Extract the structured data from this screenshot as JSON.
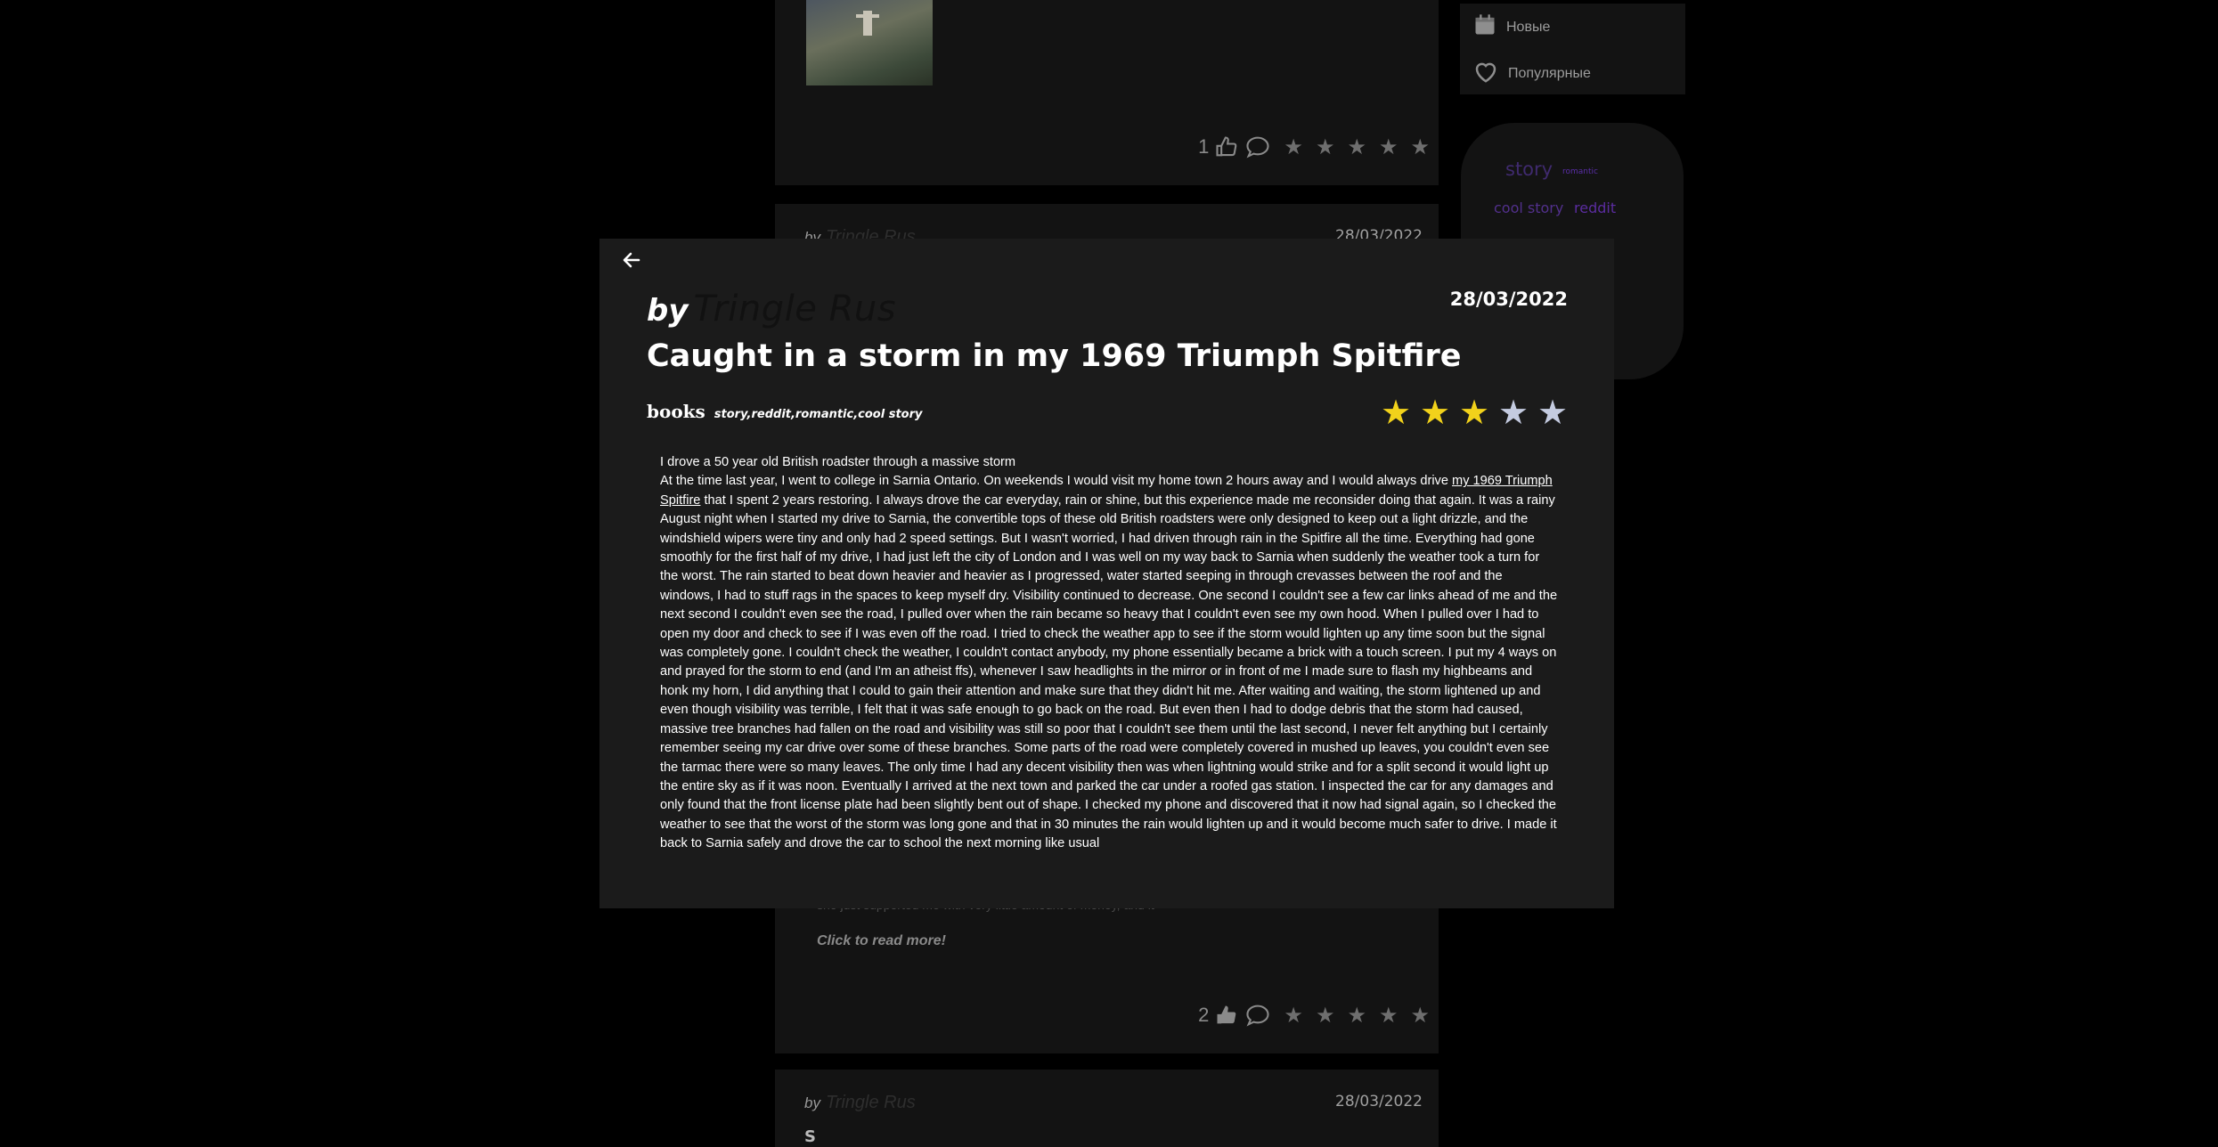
{
  "background": {
    "sidebar": {
      "items": [
        {
          "label": "Новые",
          "icon": "calendar-icon"
        },
        {
          "label": "Популярные",
          "icon": "heart-icon"
        }
      ]
    },
    "tag_cloud": [
      "story",
      "romantic",
      "cool story",
      "reddit"
    ],
    "cards": [
      {
        "likes": "1"
      },
      {
        "author": "Tringle Rus",
        "date": "28/03/2022",
        "read_more": "Click to read more!",
        "faint_text": "she just supported me with very little amount of money, and it",
        "likes": "2"
      },
      {
        "by": "by",
        "author": "Tringle Rus",
        "date": "28/03/2022",
        "initial": "S"
      }
    ]
  },
  "modal": {
    "by_label": "by",
    "author": "Tringle Rus",
    "date": "28/03/2022",
    "title": "Caught in a storm in my 1969 Triumph Spitfire",
    "category": "books",
    "tags": "story,reddit,romantic,cool story",
    "rating": 3,
    "rating_max": 5,
    "star_colors": {
      "on": "#f2d21b",
      "off": "#c4cbe0"
    },
    "body": {
      "first_line": "I drove a 50 year old British roadster through a massive storm",
      "lead": "At the time last year, I went to college in Sarnia Ontario. On weekends I would visit my home town 2 hours away and I would always drive ",
      "link": "my 1969 Triumph Spitfire",
      "rest": " that I spent 2 years restoring. I always drove the car everyday, rain or shine, but this experience made me reconsider doing that again. It was a rainy August night when I started my drive to Sarnia, the convertible tops of these old British roadsters were only designed to keep out a light drizzle, and the windshield wipers were tiny and only had 2 speed settings. But I wasn't worried, I had driven through rain in the Spitfire all the time. Everything had gone smoothly for the first half of my drive, I had just left the city of London and I was well on my way back to Sarnia when suddenly the weather took a turn for the worst. The rain started to beat down heavier and heavier as I progressed, water started seeping in through crevasses between the roof and the windows, I had to stuff rags in the spaces to keep myself dry. Visibility continued to decrease. One second I couldn't see a few car links ahead of me and the next second I couldn't even see the road, I pulled over when the rain became so heavy that I couldn't even see my own hood. When I pulled over I had to open my door and check to see if I was even off the road. I tried to check the weather app to see if the storm would lighten up any time soon but the signal was completely gone. I couldn't check the weather, I couldn't contact anybody, my phone essentially became a brick with a touch screen. I put my 4 ways on and prayed for the storm to end (and I'm an atheist ffs), whenever I saw headlights in the mirror or in front of me I made sure to flash my highbeams and honk my horn, I did anything that I could to gain their attention and make sure that they didn't hit me. After waiting and waiting, the storm lightened up and even though visibility was terrible, I felt that it was safe enough to go back on the road. But even then I had to dodge debris that the storm had caused, massive tree branches had fallen on the road and visibility was still so poor that I couldn't see them until the last second, I never felt anything but I certainly remember seeing my car drive over some of these branches. Some parts of the road were completely covered in mushed up leaves, you couldn't even see the tarmac there were so many leaves. The only time I had any decent visibility then was when lightning would strike and for a split second it would light up the entire sky as if it was noon. Eventually I arrived at the next town and parked the car under a roofed gas station. I inspected the car for any damages and only found that the front license plate had been slightly bent out of shape. I checked my phone and discovered that it now had signal again, so I checked the weather to see that the worst of the storm was long gone and that in 30 minutes the rain would lighten up and it would become much safer to drive. I made it back to Sarnia safely and drove the car to school the next morning like usual"
    }
  }
}
